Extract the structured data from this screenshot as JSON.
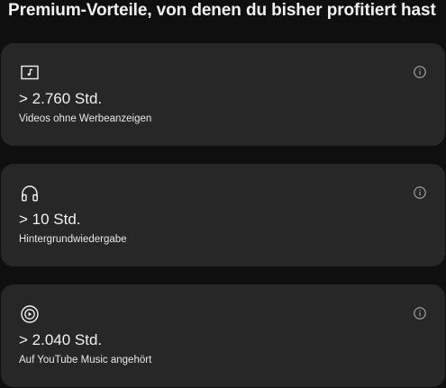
{
  "header": {
    "title": "Premium-Vorteile, von denen du bisher profitiert hast"
  },
  "benefits": [
    {
      "icon": "music-video-icon",
      "value": "> 2.760 Std.",
      "label": "Videos ohne Werbeanzeigen"
    },
    {
      "icon": "headphones-icon",
      "value": "> 10 Std.",
      "label": "Hintergrundwiedergabe"
    },
    {
      "icon": "youtube-music-icon",
      "value": "> 2.040 Std.",
      "label": "Auf YouTube Music angehört"
    }
  ],
  "colors": {
    "background": "#0f0f0f",
    "card": "#272727",
    "text": "#f1f1f1",
    "icon": "#aaaaaa"
  }
}
